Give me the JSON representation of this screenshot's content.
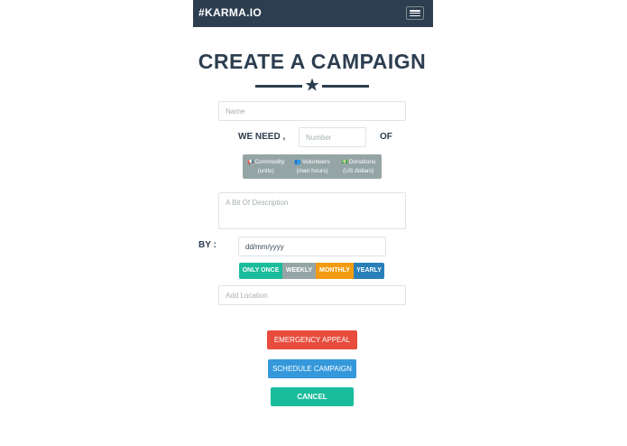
{
  "navbar": {
    "brand": "#KARMA.IO",
    "menu_icon": "hamburger-menu-icon"
  },
  "header": {
    "title": "CREATE A CAMPAIGN",
    "divider_icon": "star-icon"
  },
  "form": {
    "name_placeholder": "Name",
    "need_label": "WE NEED ,",
    "number_placeholder": "Number",
    "of_label": "OF",
    "types": [
      {
        "icon": "megaphone-icon",
        "glyph": "📢",
        "label": "Commodity",
        "sub": "(units)"
      },
      {
        "icon": "users-icon",
        "glyph": "👥",
        "label": "Volunteers",
        "sub": "(man hours)"
      },
      {
        "icon": "money-icon",
        "glyph": "💵",
        "label": "Donations",
        "sub": "(US dollars)"
      }
    ],
    "description_placeholder": "A Bit Of Description",
    "by_label": "BY :",
    "date_value": "dd/mm/yyyy",
    "frequencies": [
      "ONLY ONCE",
      "WEEKLY",
      "MONTHLY",
      "YEARLY"
    ],
    "location_placeholder": "Add Location"
  },
  "actions": {
    "emergency": "EMERGENCY APPEAL",
    "schedule": "SCHEDULE CAMPAIGN",
    "cancel": "CANCEL"
  },
  "colors": {
    "navbar": "#2c3e50",
    "teal": "#1abc9c",
    "gray": "#95a5a6",
    "orange": "#f39c12",
    "blue_dark": "#2980b9",
    "red": "#e74c3c",
    "blue": "#3498db"
  }
}
